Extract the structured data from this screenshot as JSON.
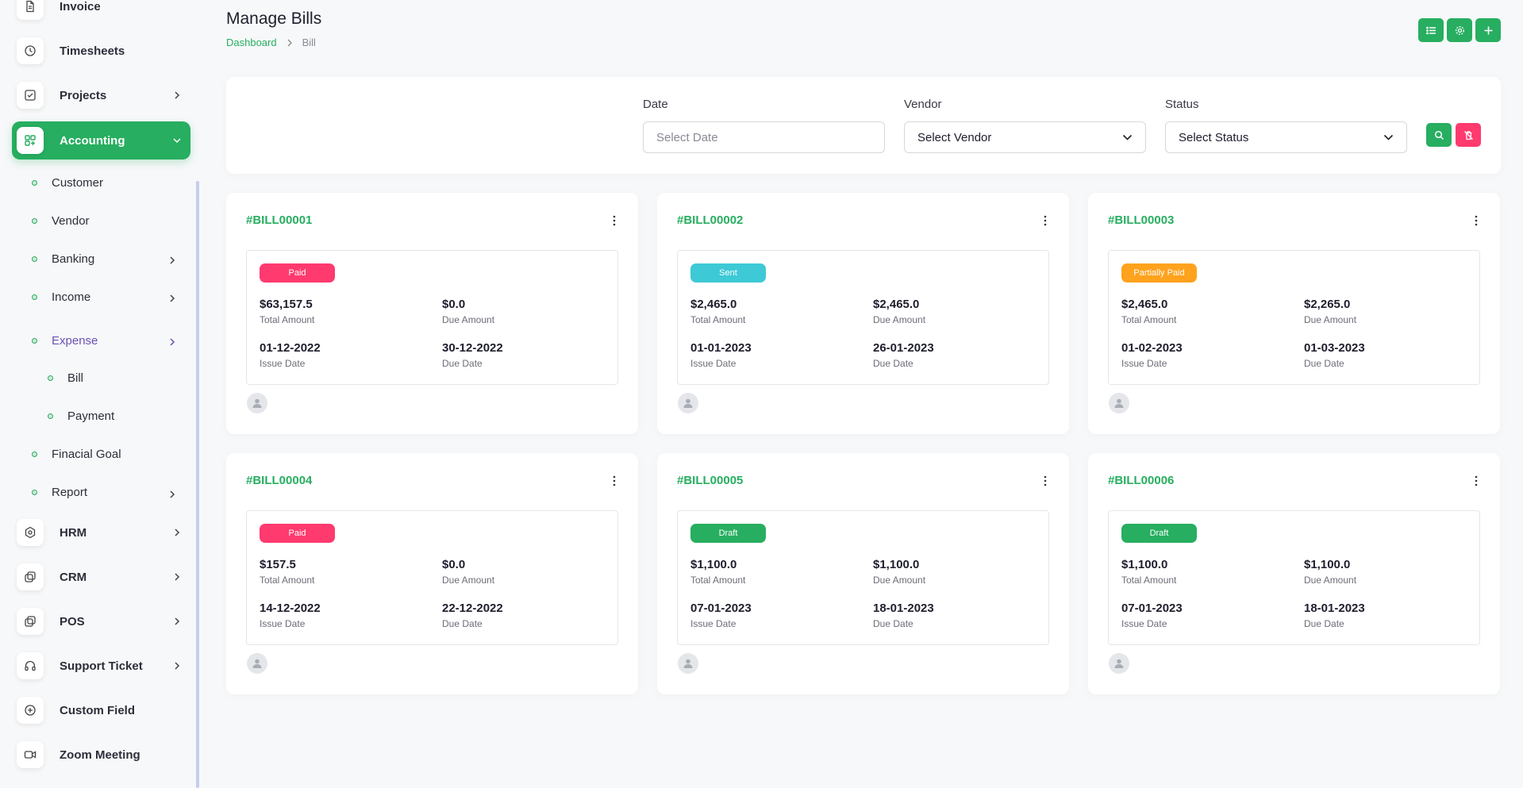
{
  "sidebar": {
    "items": [
      {
        "label": "Invoice",
        "icon": "file-icon"
      },
      {
        "label": "Timesheets",
        "icon": "clock-icon"
      },
      {
        "label": "Projects",
        "icon": "checkbox-icon"
      },
      {
        "label": "Accounting",
        "icon": "grid-plus-icon"
      },
      {
        "label": "HRM",
        "icon": "hexagon-icon"
      },
      {
        "label": "CRM",
        "icon": "layers-icon"
      },
      {
        "label": "POS",
        "icon": "layers-icon"
      },
      {
        "label": "Support Ticket",
        "icon": "headphones-icon"
      },
      {
        "label": "Custom Field",
        "icon": "plus-circle-icon"
      },
      {
        "label": "Zoom Meeting",
        "icon": "video-icon"
      }
    ],
    "accounting_sub": [
      {
        "label": "Customer"
      },
      {
        "label": "Vendor"
      },
      {
        "label": "Banking"
      },
      {
        "label": "Income"
      },
      {
        "label": "Expense"
      },
      {
        "label": "Bill"
      },
      {
        "label": "Payment"
      },
      {
        "label": "Finacial Goal"
      },
      {
        "label": "Report"
      }
    ]
  },
  "header": {
    "title": "Manage Bills",
    "breadcrumb": {
      "link": "Dashboard",
      "current": "Bill"
    }
  },
  "filters": {
    "date": {
      "label": "Date",
      "placeholder": "Select Date"
    },
    "vendor": {
      "label": "Vendor",
      "value": "Select Vendor"
    },
    "status": {
      "label": "Status",
      "value": "Select Status"
    }
  },
  "colors": {
    "accent": "#27ae60",
    "paid": "#ff3a6e",
    "sent": "#3ec9d6",
    "partially_paid": "#ffa21d",
    "draft": "#27ae60"
  },
  "bills": [
    {
      "id": "#BILL00001",
      "status": "Paid",
      "total": "$63,157.5",
      "total_label": "Total Amount",
      "due": "$0.0",
      "due_label": "Due Amount",
      "issue_date": "01-12-2022",
      "issue_label": "Issue Date",
      "due_date": "30-12-2022",
      "due_date_label": "Due Date"
    },
    {
      "id": "#BILL00002",
      "status": "Sent",
      "total": "$2,465.0",
      "total_label": "Total Amount",
      "due": "$2,465.0",
      "due_label": "Due Amount",
      "issue_date": "01-01-2023",
      "issue_label": "Issue Date",
      "due_date": "26-01-2023",
      "due_date_label": "Due Date"
    },
    {
      "id": "#BILL00003",
      "status": "Partially Paid",
      "total": "$2,465.0",
      "total_label": "Total Amount",
      "due": "$2,265.0",
      "due_label": "Due Amount",
      "issue_date": "01-02-2023",
      "issue_label": "Issue Date",
      "due_date": "01-03-2023",
      "due_date_label": "Due Date"
    },
    {
      "id": "#BILL00004",
      "status": "Paid",
      "total": "$157.5",
      "total_label": "Total Amount",
      "due": "$0.0",
      "due_label": "Due Amount",
      "issue_date": "14-12-2022",
      "issue_label": "Issue Date",
      "due_date": "22-12-2022",
      "due_date_label": "Due Date"
    },
    {
      "id": "#BILL00005",
      "status": "Draft",
      "total": "$1,100.0",
      "total_label": "Total Amount",
      "due": "$1,100.0",
      "due_label": "Due Amount",
      "issue_date": "07-01-2023",
      "issue_label": "Issue Date",
      "due_date": "18-01-2023",
      "due_date_label": "Due Date"
    },
    {
      "id": "#BILL00006",
      "status": "Draft",
      "total": "$1,100.0",
      "total_label": "Total Amount",
      "due": "$1,100.0",
      "due_label": "Due Amount",
      "issue_date": "07-01-2023",
      "issue_label": "Issue Date",
      "due_date": "18-01-2023",
      "due_date_label": "Due Date"
    }
  ]
}
